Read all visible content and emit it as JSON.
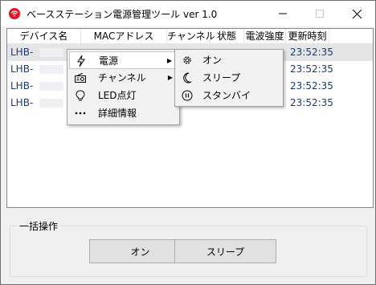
{
  "window": {
    "title": "ベースステーション電源管理ツール ver 1.0",
    "min_symbol": "—",
    "max_symbol": "☐",
    "close_symbol": "✕"
  },
  "listview": {
    "columns": [
      "デバイス名",
      "MACアドレス",
      "チャンネル",
      "状態",
      "電波強度",
      "更新時刻"
    ],
    "rows": [
      {
        "device": "LHB-",
        "time": "23:52:35",
        "selected": true
      },
      {
        "device": "LHB-",
        "time": "23:52:35",
        "selected": false
      },
      {
        "device": "LHB-",
        "time": "23:52:35",
        "selected": false
      },
      {
        "device": "LHB-",
        "time": "23:52:35",
        "selected": false
      }
    ]
  },
  "context_menu": {
    "items": [
      {
        "label": "電源",
        "icon": "lightning-icon",
        "has_submenu": true
      },
      {
        "label": "チャンネル",
        "icon": "radio-icon",
        "has_submenu": true
      },
      {
        "label": "LED点灯",
        "icon": "lightbulb-icon",
        "has_submenu": false
      },
      {
        "label": "詳細情報",
        "icon": "more-icon",
        "has_submenu": false
      }
    ]
  },
  "power_submenu": {
    "items": [
      {
        "label": "オン",
        "icon": "gear-icon"
      },
      {
        "label": "スリープ",
        "icon": "moon-icon"
      },
      {
        "label": "スタンバイ",
        "icon": "pause-circle-icon"
      }
    ]
  },
  "bulk": {
    "label": "一括操作",
    "on_button": "オン",
    "sleep_button": "スリープ"
  },
  "colors": {
    "app_icon": "#e81123",
    "link_text": "#1e3a6b"
  }
}
